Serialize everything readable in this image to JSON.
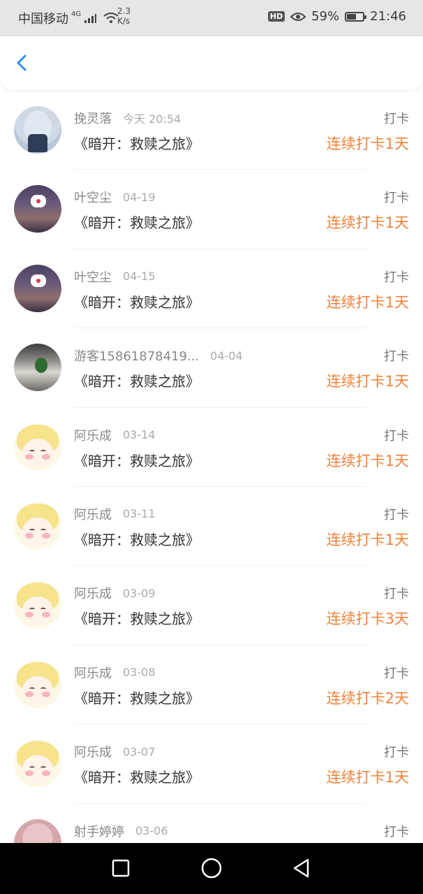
{
  "status_bar": {
    "carrier": "中国移动",
    "network": "4G",
    "speed_value": "2.3",
    "speed_unit": "K/s",
    "hd": "HD",
    "battery": "59%",
    "battery_level": 0.59,
    "time": "21:46"
  },
  "header": {
    "back_icon": "chevron-left-icon",
    "accent": "#2f8ff0"
  },
  "colors": {
    "streak": "#f0823a",
    "name": "#888888",
    "title": "#333333"
  },
  "records": [
    {
      "name": "挽灵落",
      "time": "今天 20:54",
      "tag": "打卡",
      "title": "《暗开：救赎之旅》",
      "streak": "连续打卡1天",
      "avatar": "anime-girl"
    },
    {
      "name": "叶空尘",
      "time": "04-19",
      "tag": "打卡",
      "title": "《暗开：救赎之旅》",
      "streak": "连续打卡1天",
      "avatar": "night-scene"
    },
    {
      "name": "叶空尘",
      "time": "04-15",
      "tag": "打卡",
      "title": "《暗开：救赎之旅》",
      "streak": "连续打卡1天",
      "avatar": "night-scene"
    },
    {
      "name": "游客15861878419...",
      "time": "04-04",
      "tag": "打卡",
      "title": "《暗开：救赎之旅》",
      "streak": "连续打卡1天",
      "avatar": "room-photo"
    },
    {
      "name": "阿乐成",
      "time": "03-14",
      "tag": "打卡",
      "title": "《暗开：救赎之旅》",
      "streak": "连续打卡1天",
      "avatar": "sailor-girl"
    },
    {
      "name": "阿乐成",
      "time": "03-11",
      "tag": "打卡",
      "title": "《暗开：救赎之旅》",
      "streak": "连续打卡1天",
      "avatar": "sailor-girl"
    },
    {
      "name": "阿乐成",
      "time": "03-09",
      "tag": "打卡",
      "title": "《暗开：救赎之旅》",
      "streak": "连续打卡3天",
      "avatar": "sailor-girl"
    },
    {
      "name": "阿乐成",
      "time": "03-08",
      "tag": "打卡",
      "title": "《暗开：救赎之旅》",
      "streak": "连续打卡2天",
      "avatar": "sailor-girl"
    },
    {
      "name": "阿乐成",
      "time": "03-07",
      "tag": "打卡",
      "title": "《暗开：救赎之旅》",
      "streak": "连续打卡1天",
      "avatar": "sailor-girl"
    },
    {
      "name": "射手婷婷",
      "time": "03-06",
      "tag": "打卡",
      "title": "",
      "streak": "",
      "avatar": "pink-photo"
    }
  ],
  "nav": {
    "recent_icon": "square-icon",
    "home_icon": "circle-icon",
    "back_icon": "triangle-back-icon"
  }
}
